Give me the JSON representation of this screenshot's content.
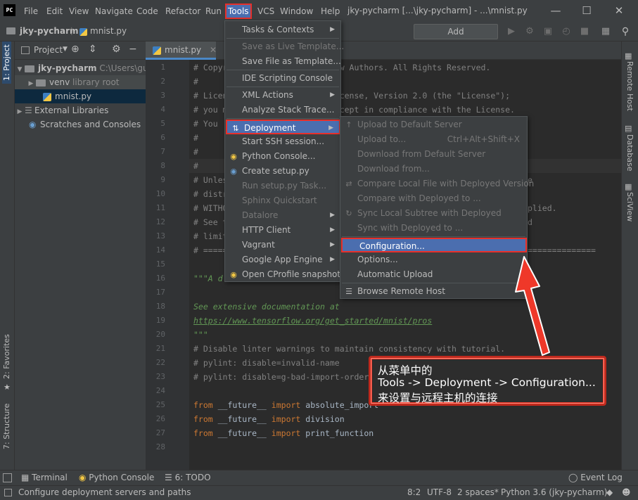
{
  "menubar": {
    "logo": "PC",
    "items": [
      "File",
      "Edit",
      "View",
      "Navigate",
      "Code",
      "Refactor",
      "Run",
      "Tools",
      "VCS",
      "Window",
      "Help"
    ],
    "window_title": "jky-pycharm [...\\jky-pycharm] - ...\\mnist.py"
  },
  "navbar": {
    "project": "jky-pycharm",
    "file": "mnist.py",
    "add_configuration": "Add Configuration..."
  },
  "left_stripe": {
    "project_tab": "1: Project",
    "favorites_tab": "2: Favorites",
    "structure_tab": "7: Structure"
  },
  "right_stripe": {
    "remote_host": "Remote Host",
    "database": "Database",
    "sciview": "SciView"
  },
  "project_panel": {
    "title": "Project",
    "root_name": "jky-pycharm",
    "root_path": "C:\\Users\\guoz",
    "venv_name": "venv",
    "venv_note": "library root",
    "file": "mnist.py",
    "external": "External Libraries",
    "scratches": "Scratches and Consoles"
  },
  "editor": {
    "tab": "mnist.py",
    "lines": [
      {
        "n": "1",
        "t": "# Copyright 2015 The TensorFlow Authors. All Rights Reserved."
      },
      {
        "n": "2",
        "t": "#"
      },
      {
        "n": "3",
        "t": "# Licensed under the Apache License, Version 2.0 (the \"License\");"
      },
      {
        "n": "4",
        "t": "# you may not use this file except in compliance with the License."
      },
      {
        "n": "5",
        "t": "# You"
      },
      {
        "n": "6",
        "t": "#"
      },
      {
        "n": "7",
        "t": "#"
      },
      {
        "n": "8",
        "t": "#"
      },
      {
        "n": "9",
        "t": "# Unles"
      },
      {
        "n": "10",
        "t": "# distr"
      },
      {
        "n": "11",
        "t": "# WITHO"
      },
      {
        "n": "12",
        "t": "# See t"
      },
      {
        "n": "13",
        "t": "# limit"
      },
      {
        "n": "14",
        "t": "# ====="
      },
      {
        "n": "15",
        "t": ""
      },
      {
        "n": "16",
        "t": "\"\"\"A d"
      },
      {
        "n": "17",
        "t": ""
      },
      {
        "n": "18",
        "t": "See extensive documentation at"
      },
      {
        "n": "19",
        "t": "https://www.tensorflow.org/get_started/mnist/pros"
      },
      {
        "n": "20",
        "t": "\"\"\""
      },
      {
        "n": "21",
        "t": "# Disable linter warnings to maintain consistency with tutorial."
      },
      {
        "n": "22",
        "t": "# pylint: disable=invalid-name"
      },
      {
        "n": "23",
        "t": "# pylint: disable=g-bad-import-order"
      },
      {
        "n": "24",
        "t": ""
      },
      {
        "n": "25",
        "t": "from __future__ import absolute_import"
      },
      {
        "n": "26",
        "t": "from __future__ import division"
      },
      {
        "n": "27",
        "t": "from __future__ import print_function"
      },
      {
        "n": "28",
        "t": ""
      }
    ],
    "right_fragments": {
      "l6": "e",
      "l10": "plied.",
      "l11": "d",
      "l13": "=============="
    }
  },
  "tools_menu": [
    {
      "label": "Tasks & Contexts",
      "sub": true,
      "disabled": false
    },
    {
      "label": "Save as Live Template...",
      "disabled": true
    },
    {
      "label": "Save File as Template...",
      "disabled": false
    },
    {
      "label": "IDE Scripting Console",
      "disabled": false
    },
    {
      "label": "XML Actions",
      "sub": true,
      "disabled": false
    },
    {
      "label": "Analyze Stack Trace...",
      "disabled": false
    },
    {
      "label": "Deployment",
      "sub": true,
      "disabled": false
    },
    {
      "label": "Start SSH session...",
      "disabled": false
    },
    {
      "label": "Python Console...",
      "disabled": false
    },
    {
      "label": "Create setup.py",
      "disabled": false
    },
    {
      "label": "Run setup.py Task...",
      "disabled": true
    },
    {
      "label": "Sphinx Quickstart",
      "disabled": true
    },
    {
      "label": "Datalore",
      "sub": true,
      "disabled": true
    },
    {
      "label": "HTTP Client",
      "sub": true,
      "disabled": false
    },
    {
      "label": "Vagrant",
      "sub": true,
      "disabled": false
    },
    {
      "label": "Google App Engine",
      "sub": true,
      "disabled": false
    },
    {
      "label": "Open CProfile snapshot",
      "disabled": false
    }
  ],
  "deployment_menu": [
    {
      "label": "Upload to Default Server",
      "disabled": true
    },
    {
      "label": "Upload to...",
      "shortcut": "Ctrl+Alt+Shift+X",
      "disabled": true
    },
    {
      "label": "Download from Default Server",
      "disabled": true
    },
    {
      "label": "Download from...",
      "disabled": true
    },
    {
      "label": "Compare Local File with Deployed Version",
      "disabled": true
    },
    {
      "label": "Compare with Deployed to ...",
      "disabled": true
    },
    {
      "label": "Sync Local Subtree with Deployed",
      "disabled": true
    },
    {
      "label": "Sync with Deployed to ...",
      "disabled": true
    },
    {
      "label": "Configuration...",
      "disabled": false
    },
    {
      "label": "Options...",
      "disabled": false
    },
    {
      "label": "Automatic Upload",
      "disabled": false
    },
    {
      "label": "Browse Remote Host",
      "disabled": false
    }
  ],
  "callout": {
    "line1": "从菜单中的",
    "line2": "Tools -> Deployment -> Configuration...",
    "line3": "来设置与远程主机的连接"
  },
  "bottom_tools": {
    "terminal": "Terminal",
    "python_console": "Python Console",
    "todo": "6: TODO",
    "event_log": "Event Log"
  },
  "status": {
    "message": "Configure deployment servers and paths",
    "position": "8:2",
    "encoding": "UTF-8",
    "indent": "2 spaces*",
    "interpreter": "Python 3.6 (jky-pycharm)"
  },
  "colors": {
    "highlight": "#4b6eaf",
    "annotation_red": "#e8302a"
  }
}
